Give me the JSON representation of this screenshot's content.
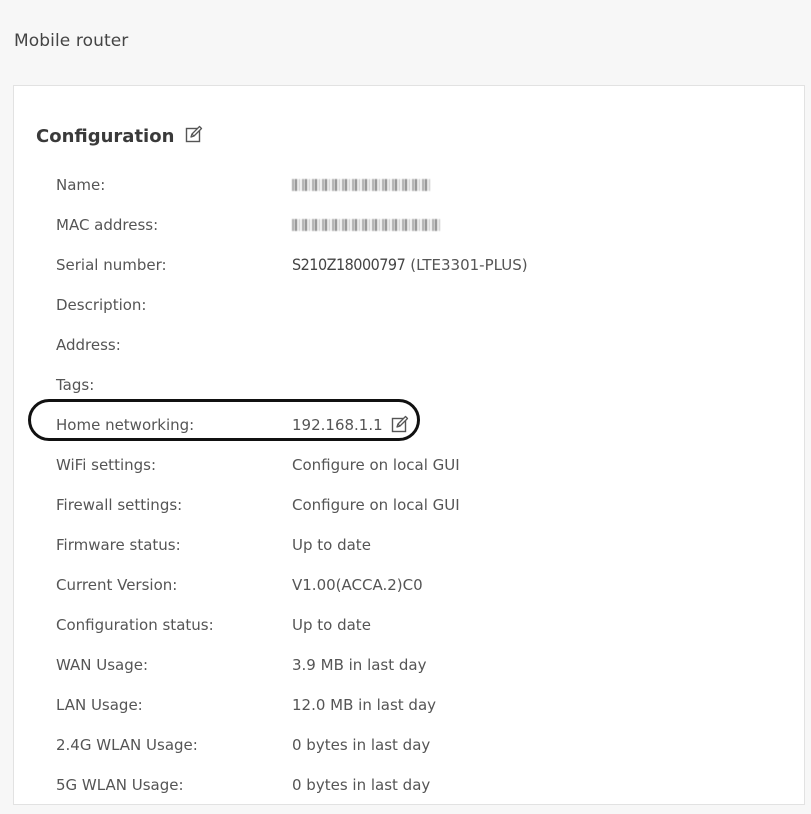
{
  "page": {
    "title": "Mobile router"
  },
  "configuration": {
    "title": "Configuration",
    "edit_icon": "pencil-edit-icon",
    "rows": [
      {
        "label": "Name:",
        "value": "",
        "redacted": true
      },
      {
        "label": "MAC address:",
        "value": "",
        "redacted": true
      },
      {
        "label": "Serial number:",
        "serial_code": "S210Z18000797",
        "serial_model": "(LTE3301-PLUS)"
      },
      {
        "label": "Description:",
        "value": ""
      },
      {
        "label": "Address:",
        "value": ""
      },
      {
        "label": "Tags:",
        "value": ""
      },
      {
        "label": "Home networking:",
        "value": "192.168.1.1",
        "editable": true
      },
      {
        "label": "WiFi settings:",
        "value": "Configure on local GUI"
      },
      {
        "label": "Firewall settings:",
        "value": "Configure on local GUI"
      },
      {
        "label": "Firmware status:",
        "value": "Up to date"
      },
      {
        "label": "Current Version:",
        "value": "V1.00(ACCA.2)C0"
      },
      {
        "label": "Configuration status:",
        "value": "Up to date"
      },
      {
        "label": "WAN Usage:",
        "value": "3.9 MB in last day"
      },
      {
        "label": "LAN Usage:",
        "value": "12.0 MB in last day"
      },
      {
        "label": "2.4G WLAN Usage:",
        "value": "0 bytes in last day"
      },
      {
        "label": "5G WLAN Usage:",
        "value": "0 bytes in last day"
      }
    ]
  },
  "colors": {
    "background": "#f7f7f7",
    "card": "#ffffff",
    "text": "#555555",
    "title": "#3a3a3a",
    "annotation": "#111111"
  }
}
